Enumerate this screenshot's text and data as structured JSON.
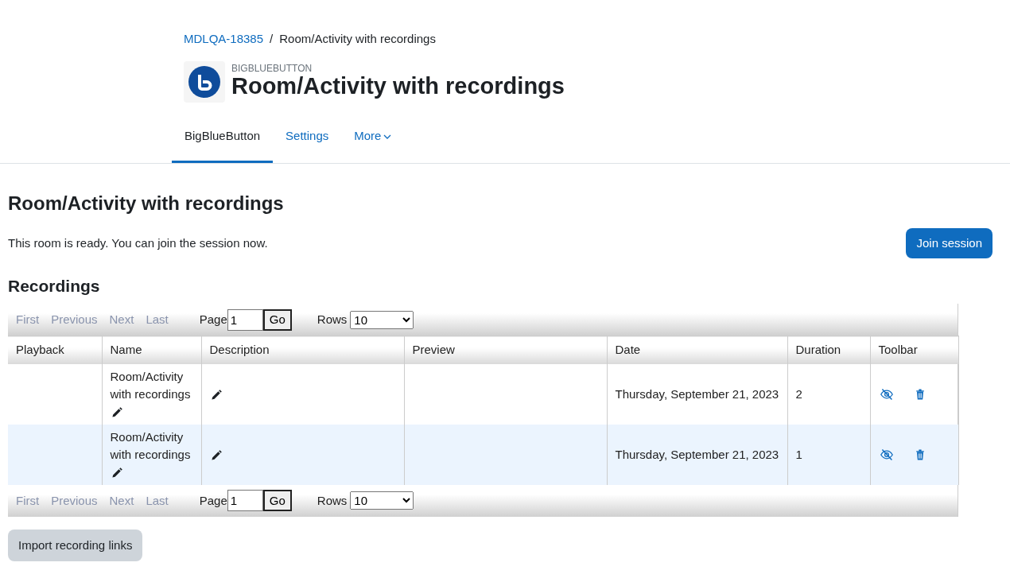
{
  "breadcrumb_separator": "/",
  "breadcrumb": [
    {
      "label": "MDLQA-18385",
      "link": true
    },
    {
      "label": "Room/Activity with recordings",
      "link": false
    }
  ],
  "header": {
    "kind_label": "BIGBLUEBUTTON",
    "title": "Room/Activity with recordings"
  },
  "tabs": [
    {
      "label": "BigBlueButton",
      "selected": true,
      "dropdown": false
    },
    {
      "label": "Settings",
      "selected": false,
      "dropdown": false
    },
    {
      "label": "More",
      "selected": false,
      "dropdown": true
    }
  ],
  "page_title": "Room/Activity with recordings",
  "status_message": "This room is ready. You can join the session now.",
  "join_button": "Join session",
  "recordings_heading": "Recordings",
  "pager_top": {
    "links": [
      {
        "label": "First",
        "disabled": true
      },
      {
        "label": "Previous",
        "disabled": true
      },
      {
        "label": "Next",
        "disabled": true
      },
      {
        "label": "Last",
        "disabled": true
      }
    ],
    "page_label": "Page",
    "page_value": "1",
    "go": "Go",
    "rows_label": "Rows",
    "rows_value": "10"
  },
  "table": {
    "columns": [
      "Playback",
      "Name",
      "Description",
      "Preview",
      "Date",
      "Duration",
      "Toolbar"
    ],
    "rows": [
      {
        "name": "Room/Activity with recordings",
        "date": "Thursday, September 21, 2023",
        "duration": "2",
        "selected": false
      },
      {
        "name": "Room/Activity with recordings",
        "date": "Thursday, September 21, 2023",
        "duration": "1",
        "selected": true
      }
    ]
  },
  "pager_bottom": {
    "links": [
      {
        "label": "First",
        "disabled": true
      },
      {
        "label": "Previous",
        "disabled": true
      },
      {
        "label": "Next",
        "disabled": true
      },
      {
        "label": "Last",
        "disabled": true
      }
    ],
    "page_label": "Page",
    "page_value": "1",
    "go": "Go",
    "rows_label": "Rows",
    "rows_value": "10"
  },
  "import_button": "Import recording links"
}
